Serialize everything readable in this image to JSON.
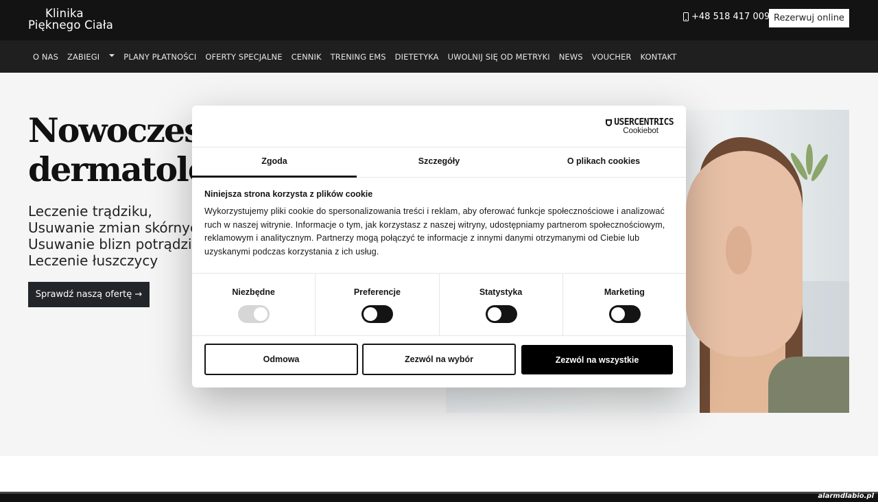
{
  "header": {
    "logo_line1": "Klinika",
    "logo_line2": "Pięknego Ciała",
    "phone": "+48 518 417 009",
    "book_button": "Rezerwuj online"
  },
  "nav": {
    "items": [
      "O NAS",
      "ZABIEGI",
      "PLANY PŁATNOŚCI",
      "OFERTY SPECJALNE",
      "CENNIK",
      "TRENING EMS",
      "DIETETYKA",
      "UWOLNIJ SIĘ OD METRYKI",
      "NEWS",
      "VOUCHER",
      "KONTAKT"
    ]
  },
  "hero": {
    "title_line1": "Nowoczesn",
    "title_line2": "dermatolog",
    "list": [
      "Leczenie trądziku,",
      "Usuwanie zmian skórnyc",
      "Usuwanie blizn potrądzi",
      "Leczenie łuszczycy"
    ],
    "cta_label": "Sprawdź naszą ofertę",
    "cta_arrow": "→"
  },
  "cookie_dialog": {
    "brand_name": "USERCENTRICS",
    "brand_sub": "Cookiebot",
    "tabs": [
      "Zgoda",
      "Szczegóły",
      "O plikach cookies"
    ],
    "active_tab": "Zgoda",
    "title": "Niniejsza strona korzysta z plików cookie",
    "text": "Wykorzystujemy pliki cookie do spersonalizowania treści i reklam, aby oferować funkcje społecznościowe i analizować ruch w naszej witrynie. Informacje o tym, jak korzystasz z naszej witryny, udostępniamy partnerom społecznościowym, reklamowym i analitycznym. Partnerzy mogą połączyć te informacje z innymi danymi otrzymanymi od Ciebie lub uzyskanymi podczas korzystania z ich usług.",
    "toggles": [
      {
        "label": "Niezbędne",
        "state": "on-disabled"
      },
      {
        "label": "Preferencje",
        "state": "off"
      },
      {
        "label": "Statystyka",
        "state": "off"
      },
      {
        "label": "Marketing",
        "state": "off"
      }
    ],
    "buttons": {
      "deny": "Odmowa",
      "allow_selection": "Zezwól na wybór",
      "allow_all": "Zezwól na wszystkie"
    }
  },
  "watermark": "alarmdlabio.pl",
  "colors": {
    "header_bg": "#131313",
    "nav_bg": "#1f1f1f",
    "hero_bg": "#f5f5f5",
    "cta_bg": "#222529",
    "dialog_text": "#141414"
  }
}
